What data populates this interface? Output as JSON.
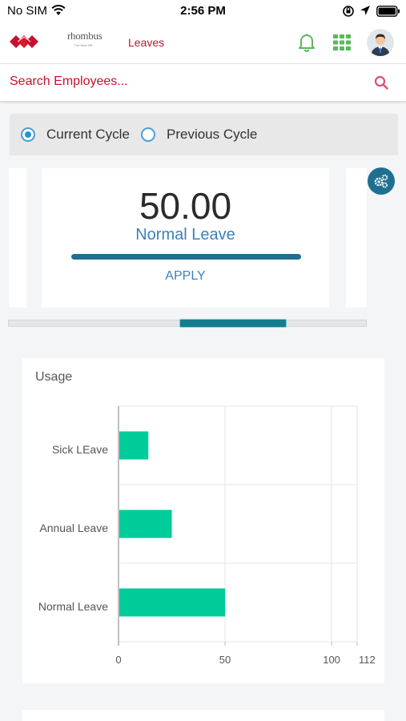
{
  "status_bar": {
    "carrier": "No SIM",
    "time": "2:56 PM"
  },
  "header": {
    "brand_name": "rhombus",
    "brand_tagline": "The New HR",
    "nav_title": "Leaves",
    "colors": {
      "brand_red": "#c8102e",
      "bell_green": "#5cb85c",
      "grid_green": "#5cb85c"
    }
  },
  "search": {
    "placeholder": "Search Employees..."
  },
  "cycle": {
    "current_label": "Current Cycle",
    "previous_label": "Previous Cycle",
    "selected": "current"
  },
  "balance_card": {
    "amount": "50.00",
    "leave_type": "Normal Leave",
    "apply_label": "APPLY"
  },
  "usage": {
    "title": "Usage"
  },
  "chart_data": {
    "type": "bar",
    "orientation": "horizontal",
    "title": "Usage",
    "categories": [
      "Sick LEave",
      "Annual Leave",
      "Normal Leave"
    ],
    "values": [
      14,
      25,
      50
    ],
    "xlim": [
      0,
      112
    ],
    "xticks": [
      0,
      50,
      100,
      112
    ],
    "grid": true,
    "bar_color": "#00cc99"
  }
}
